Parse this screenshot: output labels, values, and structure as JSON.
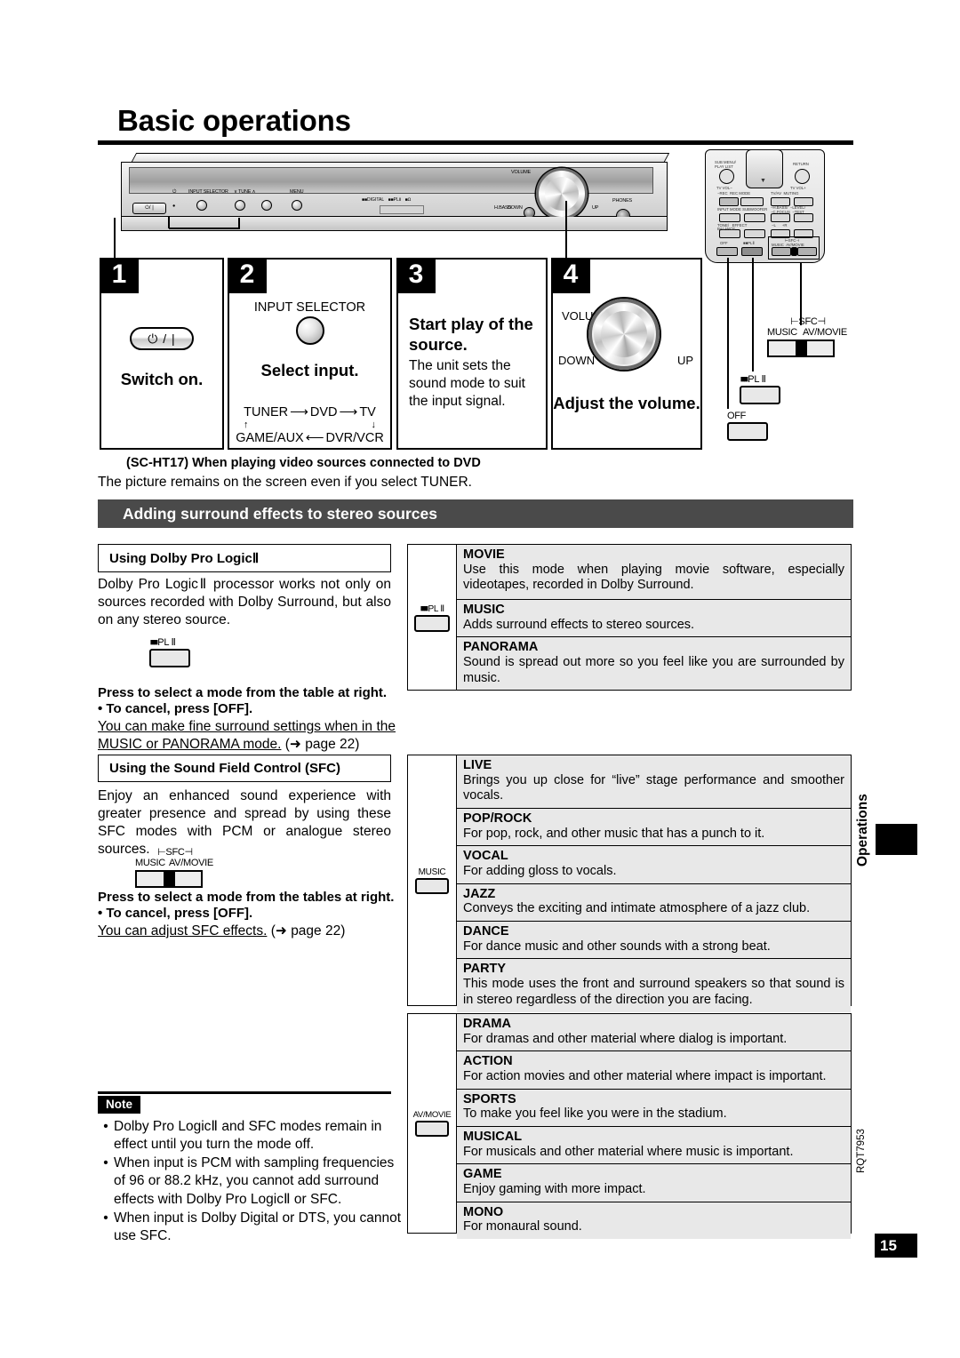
{
  "page": {
    "title": "Basic operations",
    "number": "15",
    "side_tab": "Operations",
    "doc_code": "RQT7953"
  },
  "steps": [
    {
      "num": "1",
      "heading": "Switch on.",
      "button_label": "⏻ / |"
    },
    {
      "num": "2",
      "heading": "Select input.",
      "control_label": "INPUT SELECTOR",
      "flow": {
        "top": [
          "TUNER",
          "DVD",
          "TV"
        ],
        "bottom": [
          "GAME/AUX",
          "DVR/VCR"
        ]
      }
    },
    {
      "num": "3",
      "heading": "Start play of the source.",
      "body": "The unit sets the sound mode to suit the input signal."
    },
    {
      "num": "4",
      "heading": "Adjust the volume.",
      "knob_labels": {
        "top": "VOLUME",
        "left": "DOWN",
        "right": "UP"
      }
    }
  ],
  "device_labels": {
    "power": "⏻/ |",
    "input_selector": "INPUT SELECTOR",
    "tune": "TUNE",
    "menu": "MENU",
    "h_bass": "H.BASS",
    "volume": "VOLUME",
    "down": "DOWN",
    "up": "UP",
    "phones": "PHONES",
    "indicators": [
      "DIGITAL",
      "PL II",
      "4Ω"
    ]
  },
  "remote_callouts": {
    "off": "OFF",
    "pl2": "PL Ⅱ",
    "sfc": "SFC",
    "sfc_music": "MUSIC",
    "sfc_avmovie": "AV/MOVIE"
  },
  "model_note": {
    "heading": "(SC-HT17) When playing video sources connected to DVD",
    "body": "The picture remains on the screen even if you select TUNER."
  },
  "section_bar": "Adding surround effects to stereo sources",
  "dolby": {
    "subhead": "Using Dolby Pro LogicⅡ",
    "paragraph": "Dolby Pro LogicⅡ processor works not only on sources recorded with Dolby Surround, but also on any stereo source.",
    "button_label": "PL Ⅱ",
    "instruction": "Press to select a mode from the table at right.",
    "cancel": "To cancel, press [OFF].",
    "fine_note": "You can make fine surround settings when in the",
    "fine_note2": "MUSIC or PANORAMA mode.",
    "page_ref": "(➜ page 22)"
  },
  "sfc": {
    "subhead": "Using the Sound Field Control (SFC)",
    "paragraph": "Enjoy an enhanced sound experience with greater presence and spread by using these SFC modes with PCM or analogue stereo sources.",
    "switch_label": "SFC",
    "switch_left": "MUSIC",
    "switch_right": "AV/MOVIE",
    "instruction": "Press to select a mode from the tables at right.",
    "cancel": "To cancel, press [OFF].",
    "adjust_note": "You can adjust SFC effects.",
    "page_ref": "(➜ page 22)"
  },
  "tables": [
    {
      "icon_label": "PL Ⅱ",
      "icon_type": "pl2-button",
      "rows": [
        {
          "mode": "MOVIE",
          "desc": "Use this mode when playing movie software, especially videotapes, recorded in Dolby Surround."
        },
        {
          "mode": "MUSIC",
          "desc": "Adds surround effects to stereo sources."
        },
        {
          "mode": "PANORAMA",
          "desc": "Sound is spread out more so you feel like you are surrounded by music."
        }
      ]
    },
    {
      "icon_label": "MUSIC",
      "icon_type": "plain-button",
      "rows": [
        {
          "mode": "LIVE",
          "desc": "Brings you up close for “live” stage performance and smoother vocals."
        },
        {
          "mode": "POP/ROCK",
          "desc": "For pop, rock, and other music that has a punch to it."
        },
        {
          "mode": "VOCAL",
          "desc": "For adding gloss to vocals."
        },
        {
          "mode": "JAZZ",
          "desc": "Conveys the exciting and intimate atmosphere of a jazz club."
        },
        {
          "mode": "DANCE",
          "desc": "For dance music and other sounds with a strong beat."
        },
        {
          "mode": "PARTY",
          "desc": "This mode uses the front and surround speakers so that sound is in stereo regardless of the direction you are facing."
        }
      ]
    },
    {
      "icon_label": "AV/MOVIE",
      "icon_type": "plain-button",
      "rows": [
        {
          "mode": "DRAMA",
          "desc": "For dramas and other material where dialog is important."
        },
        {
          "mode": "ACTION",
          "desc": "For action movies and other material where impact is important."
        },
        {
          "mode": "SPORTS",
          "desc": "To make you feel like you were in the stadium."
        },
        {
          "mode": "MUSICAL",
          "desc": "For musicals and other material where music is important."
        },
        {
          "mode": "GAME",
          "desc": "Enjoy gaming with more impact."
        },
        {
          "mode": "MONO",
          "desc": "For monaural sound."
        }
      ]
    }
  ],
  "note": {
    "label": "Note",
    "items": [
      "Dolby Pro LogicⅡ and SFC modes remain in effect until you turn the mode off.",
      "When input is PCM with sampling frequencies of 96 or 88.2 kHz, you cannot add surround effects with Dolby Pro LogicⅡ or SFC.",
      "When input is Dolby Digital or DTS, you cannot use SFC."
    ]
  },
  "colors": {
    "section_bar_bg": "#4a4a4a",
    "table_row_bg": "#e8e8e8",
    "ink": "#000000"
  }
}
